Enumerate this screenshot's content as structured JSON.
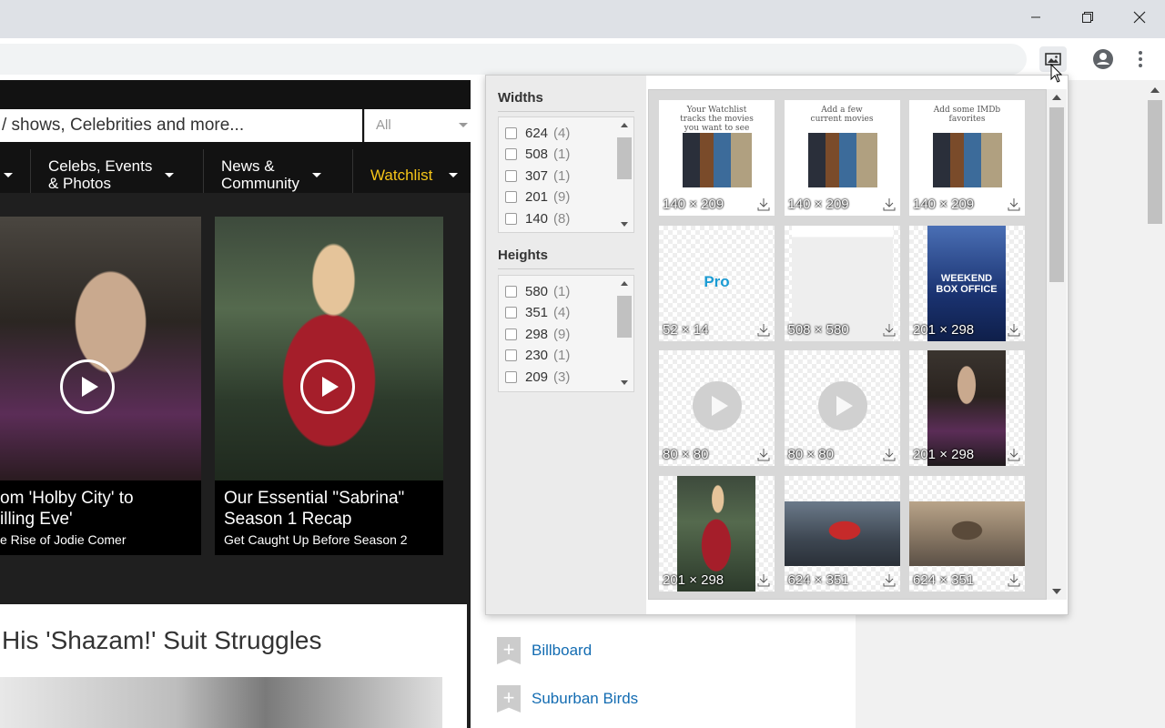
{
  "browser": {
    "extension_icon": "image-gallery-icon",
    "window_buttons": [
      "minimize",
      "restore",
      "close"
    ]
  },
  "imdb": {
    "search_placeholder": "/ shows, Celebrities and more...",
    "search_category": "All",
    "nav": [
      {
        "label": "Celebs, Events\n& Photos"
      },
      {
        "label": "News &\nCommunity"
      },
      {
        "label": "Watchlist"
      }
    ],
    "cards": [
      {
        "title": "om 'Holby City' to\nilling Eve'",
        "subtitle": "e Rise of Jodie Comer"
      },
      {
        "title": "Our Essential \"Sabrina\"\nSeason 1 Recap",
        "subtitle": "Get Caught Up Before Season 2"
      }
    ],
    "article_title": "His 'Shazam!' Suit Struggles",
    "side_links": [
      "Billboard",
      "Suburban Birds"
    ]
  },
  "popup": {
    "widths_title": "Widths",
    "widths": [
      {
        "value": "624",
        "count": "(4)"
      },
      {
        "value": "508",
        "count": "(1)"
      },
      {
        "value": "307",
        "count": "(1)"
      },
      {
        "value": "201",
        "count": "(9)"
      },
      {
        "value": "140",
        "count": "(8)"
      }
    ],
    "heights_title": "Heights",
    "heights": [
      {
        "value": "580",
        "count": "(1)"
      },
      {
        "value": "351",
        "count": "(4)"
      },
      {
        "value": "298",
        "count": "(9)"
      },
      {
        "value": "230",
        "count": "(1)"
      },
      {
        "value": "209",
        "count": "(3)"
      }
    ],
    "images": [
      {
        "dims": "140 × 209",
        "kind": "poster",
        "caption": "Your Watchlist\ntracks the movies\nyou want to see"
      },
      {
        "dims": "140 × 209",
        "kind": "poster",
        "caption": "Add a few\ncurrent movies"
      },
      {
        "dims": "140 × 209",
        "kind": "poster",
        "caption": "Add some IMDb\nfavorites"
      },
      {
        "dims": "52 × 14",
        "kind": "pro",
        "caption": "Pro"
      },
      {
        "dims": "508 × 580",
        "kind": "profile"
      },
      {
        "dims": "201 × 298",
        "kind": "boxoffice",
        "caption": "WEEKEND\nBOX OFFICE"
      },
      {
        "dims": "80 × 80",
        "kind": "play"
      },
      {
        "dims": "80 × 80",
        "kind": "play"
      },
      {
        "dims": "201 × 298",
        "kind": "photo-dark"
      },
      {
        "dims": "201 × 298",
        "kind": "photo-red"
      },
      {
        "dims": "624 × 351",
        "kind": "photo-wide-a"
      },
      {
        "dims": "624 × 351",
        "kind": "photo-wide-b"
      }
    ]
  }
}
